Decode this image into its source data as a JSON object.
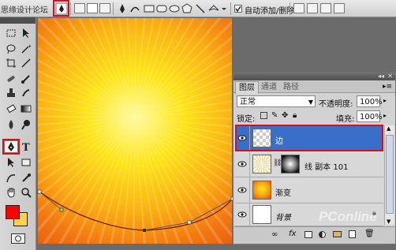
{
  "options_bar": {
    "title_watermark": "思缘设计论坛",
    "auto_add_delete_label": "自动添加/删除",
    "auto_add_delete_checked": true
  },
  "layers_panel": {
    "tabs": [
      "图层",
      "通道",
      "路径"
    ],
    "active_tab": "图层",
    "blend_mode": "正常",
    "opacity_label": "不透明度:",
    "opacity_value": "100%",
    "lock_label": "锁定:",
    "fill_label": "填充:",
    "fill_value": "100%",
    "layers": [
      {
        "name": "边",
        "selected": true
      },
      {
        "name": "线 副本 101",
        "selected": false
      },
      {
        "name": "渐变",
        "selected": false
      },
      {
        "name": "背景",
        "selected": false
      }
    ]
  },
  "colors": {
    "foreground": "#ff0000",
    "background": "#ffd24a",
    "selection": "#3a6fc9",
    "highlight": "#d8101a"
  },
  "watermark": "PConline",
  "icons": [
    "pen-tool-icon",
    "move-icon",
    "lasso-icon",
    "brush-icon",
    "text-icon",
    "hand-icon",
    "zoom-icon",
    "eye-icon",
    "lock-icon"
  ]
}
